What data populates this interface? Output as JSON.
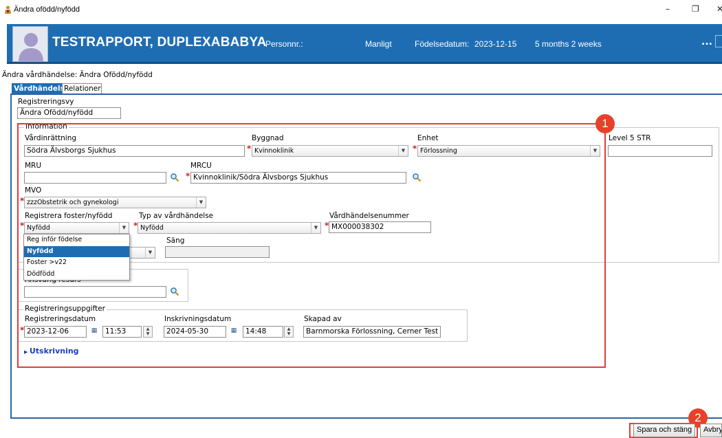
{
  "window": {
    "title": "Ändra ofödd/nyfödd",
    "minimize": "–",
    "restore": "❐",
    "close": "✕"
  },
  "banner": {
    "name": "TESTRAPPORT, DUPLEXABABYA",
    "personnr_label": "Personnr.:",
    "gender": "Manligt",
    "birthdate_label": "Födelsedatum:",
    "birthdate": "2023-12-15",
    "age": "5 months 2 weeks",
    "more": "...",
    "color": "#1e6db3"
  },
  "breadcrumb": "Ändra vårdhändelse: Ändra Ofödd/nyfödd",
  "tabs": [
    {
      "label": "Vårdhändelse",
      "active": true
    },
    {
      "label": "Relationer",
      "active": false
    }
  ],
  "registreringsvy": {
    "label": "Registreringsvy",
    "value": "Ändra Ofödd/nyfödd"
  },
  "information": {
    "title": "Information",
    "vardinrattning": {
      "label": "Vårdinrättning",
      "value": "Södra Älvsborgs Sjukhus"
    },
    "byggnad": {
      "label": "Byggnad",
      "value": "Kvinnoklinik"
    },
    "enhet": {
      "label": "Enhet",
      "value": "Förlossning"
    },
    "level": {
      "label": "Level 5 STR",
      "value": ""
    },
    "mru": {
      "label": "MRU",
      "value": ""
    },
    "mrcu": {
      "label": "MRCU",
      "value": "Kvinnoklinik/Södra Älvsborgs Sjukhus"
    },
    "mvo": {
      "label": "MVO",
      "value": "zzzObstetrik och gynekologi"
    },
    "foster": {
      "label": "Registrera foster/nyfödd",
      "value": "Nyfödd"
    },
    "typ": {
      "label": "Typ av vårdhändelse",
      "value": "Nyfödd"
    },
    "nummer": {
      "label": "Vårdhändelsenummer",
      "value": "MX000038302"
    },
    "sang": {
      "label": "Säng",
      "value": ""
    }
  },
  "dropdown_options": [
    {
      "label": "Reg inför födelse",
      "selected": false
    },
    {
      "label": "Nyfödd",
      "selected": true
    },
    {
      "label": "Foster >v22",
      "selected": false
    },
    {
      "label": "Dödfödd",
      "selected": false
    }
  ],
  "ansvarig": {
    "label": "Ansvarig resurs",
    "value": ""
  },
  "registrering": {
    "title": "Registreringsuppgifter",
    "reg_datum": {
      "label": "Registreringsdatum",
      "date": "2023-12-06",
      "time": "11:53"
    },
    "inskr_datum": {
      "label": "Inskrivningsdatum",
      "date": "2024-05-30",
      "time": "14:48"
    },
    "skapad_av": {
      "label": "Skapad av",
      "value": "Barnmorska Förlossning, Cerner Test"
    }
  },
  "utskrivning": "Utskrivning",
  "badges": {
    "one": "1",
    "two": "2"
  },
  "buttons": {
    "save": "Spara och stäng",
    "cancel": "Avbry"
  },
  "highlight_color": "#e03b3b"
}
